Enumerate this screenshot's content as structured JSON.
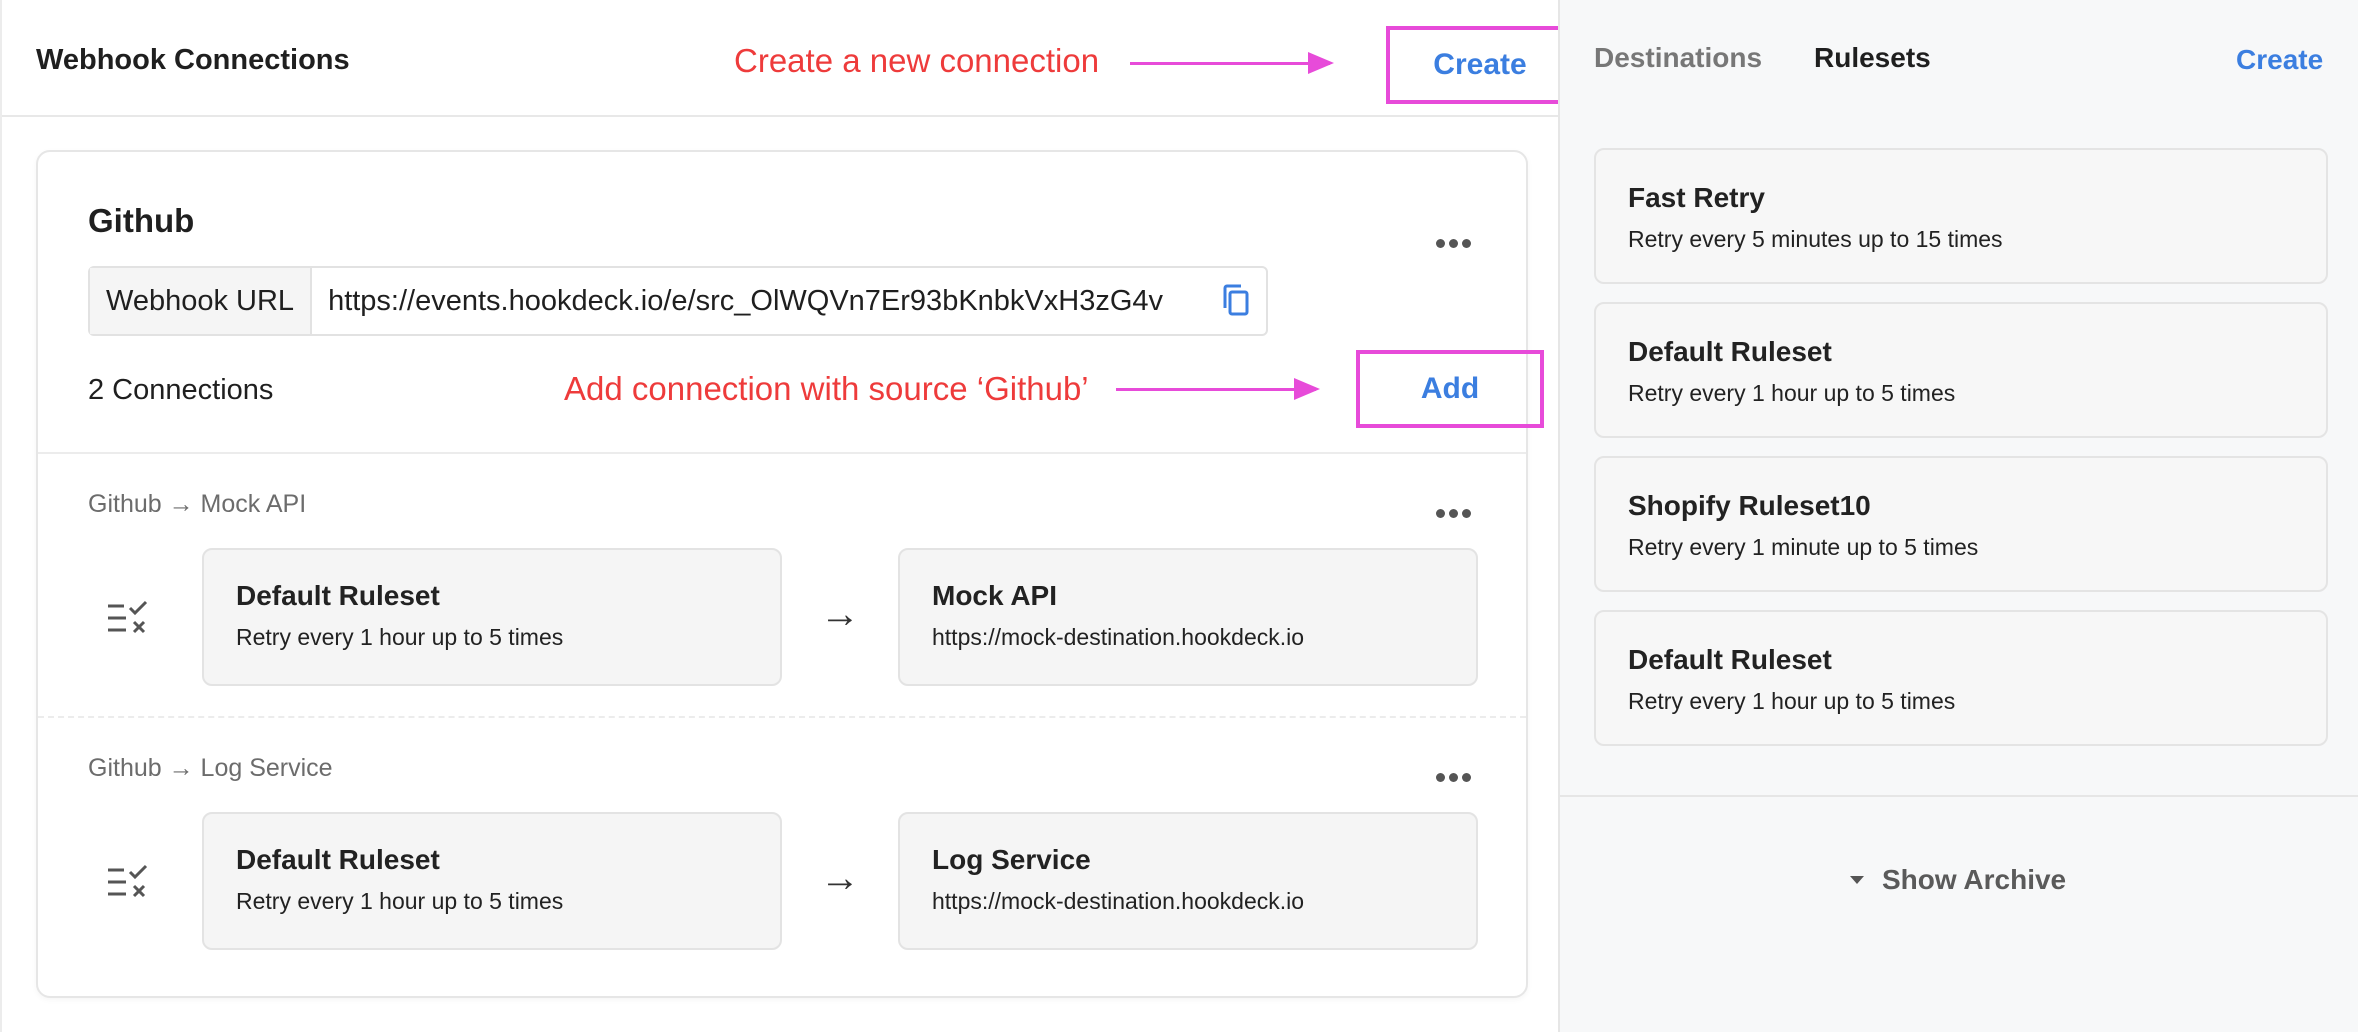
{
  "header": {
    "title": "Webhook Connections",
    "create_label": "Create",
    "create_note": "Create a new connection"
  },
  "source": {
    "name": "Github",
    "webhook_label": "Webhook URL",
    "webhook_url": "https://events.hookdeck.io/e/src_OlWQVn7Er93bKnbkVxH3zG4v",
    "connection_count": "2 Connections",
    "add_label": "Add",
    "add_note": "Add connection with source ‘Github’"
  },
  "connections": [
    {
      "title": "Github → Mock API",
      "ruleset": {
        "name": "Default Ruleset",
        "desc": "Retry every 1 hour up to 5 times"
      },
      "destination": {
        "name": "Mock API",
        "url": "https://mock-destination.hookdeck.io"
      }
    },
    {
      "title": "Github → Log Service",
      "ruleset": {
        "name": "Default Ruleset",
        "desc": "Retry every 1 hour up to 5 times"
      },
      "destination": {
        "name": "Log Service",
        "url": "https://mock-destination.hookdeck.io"
      }
    }
  ],
  "right": {
    "tabs": [
      {
        "label": "Destinations",
        "active": false
      },
      {
        "label": "Rulesets",
        "active": true
      }
    ],
    "create_label": "Create",
    "rulesets": [
      {
        "name": "Fast Retry",
        "desc": "Retry every 5 minutes up to 15 times"
      },
      {
        "name": "Default Ruleset",
        "desc": "Retry every 1 hour up to 5 times"
      },
      {
        "name": "Shopify Ruleset10",
        "desc": "Retry every 1 minute up to 5 times"
      },
      {
        "name": "Default Ruleset",
        "desc": "Retry every 1 hour up to 5 times"
      }
    ],
    "show_archive_label": "Show Archive"
  },
  "colors": {
    "accent": "#3b7ee0",
    "annotation_text": "#ee3b3b",
    "annotation_highlight": "#e74bd9"
  },
  "icons": [
    "copy-icon",
    "more-icon",
    "ruleset-icon",
    "arrow-right-icon",
    "caret-down-icon"
  ]
}
